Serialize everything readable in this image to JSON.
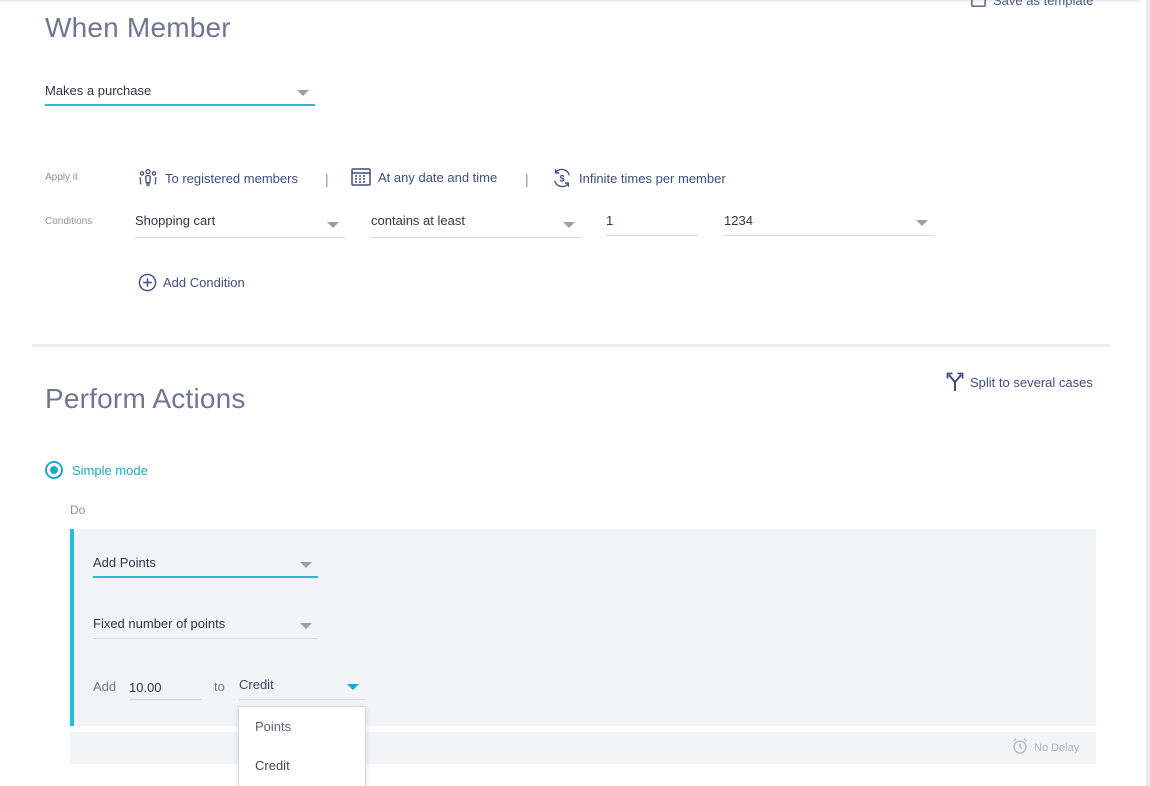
{
  "header": {
    "save_template_label": "Save as template"
  },
  "when_member": {
    "title": "When Member",
    "trigger_select": "Makes a purchase",
    "apply_label": "Apply it",
    "apply_items": [
      {
        "label": "To registered members",
        "icon": "members-icon"
      },
      {
        "label": "At any date and time",
        "icon": "calendar-icon"
      },
      {
        "label": "Infinite times per member",
        "icon": "repeat-dollar-icon"
      }
    ],
    "separator": "|",
    "conditions_label": "Conditions",
    "condition": {
      "field": "Shopping cart",
      "operator": "contains at least",
      "quantity": "1",
      "item": "1234"
    },
    "add_condition_label": "Add Condition"
  },
  "perform_actions": {
    "title": "Perform Actions",
    "split_label": "Split to several cases",
    "mode_label": "Simple mode",
    "do_label": "Do",
    "action_select": "Add Points",
    "points_type_select": "Fixed number of points",
    "add_label": "Add",
    "amount_value": "10.00",
    "to_label": "to",
    "budget_select": "Credit",
    "budget_options": [
      "Points",
      "Credit"
    ],
    "delay_label": "No Delay"
  },
  "colors": {
    "accent": "#1ea7d3",
    "panel_border": "#1ec0dc",
    "link": "#3f4d82",
    "title": "#6f7691"
  }
}
